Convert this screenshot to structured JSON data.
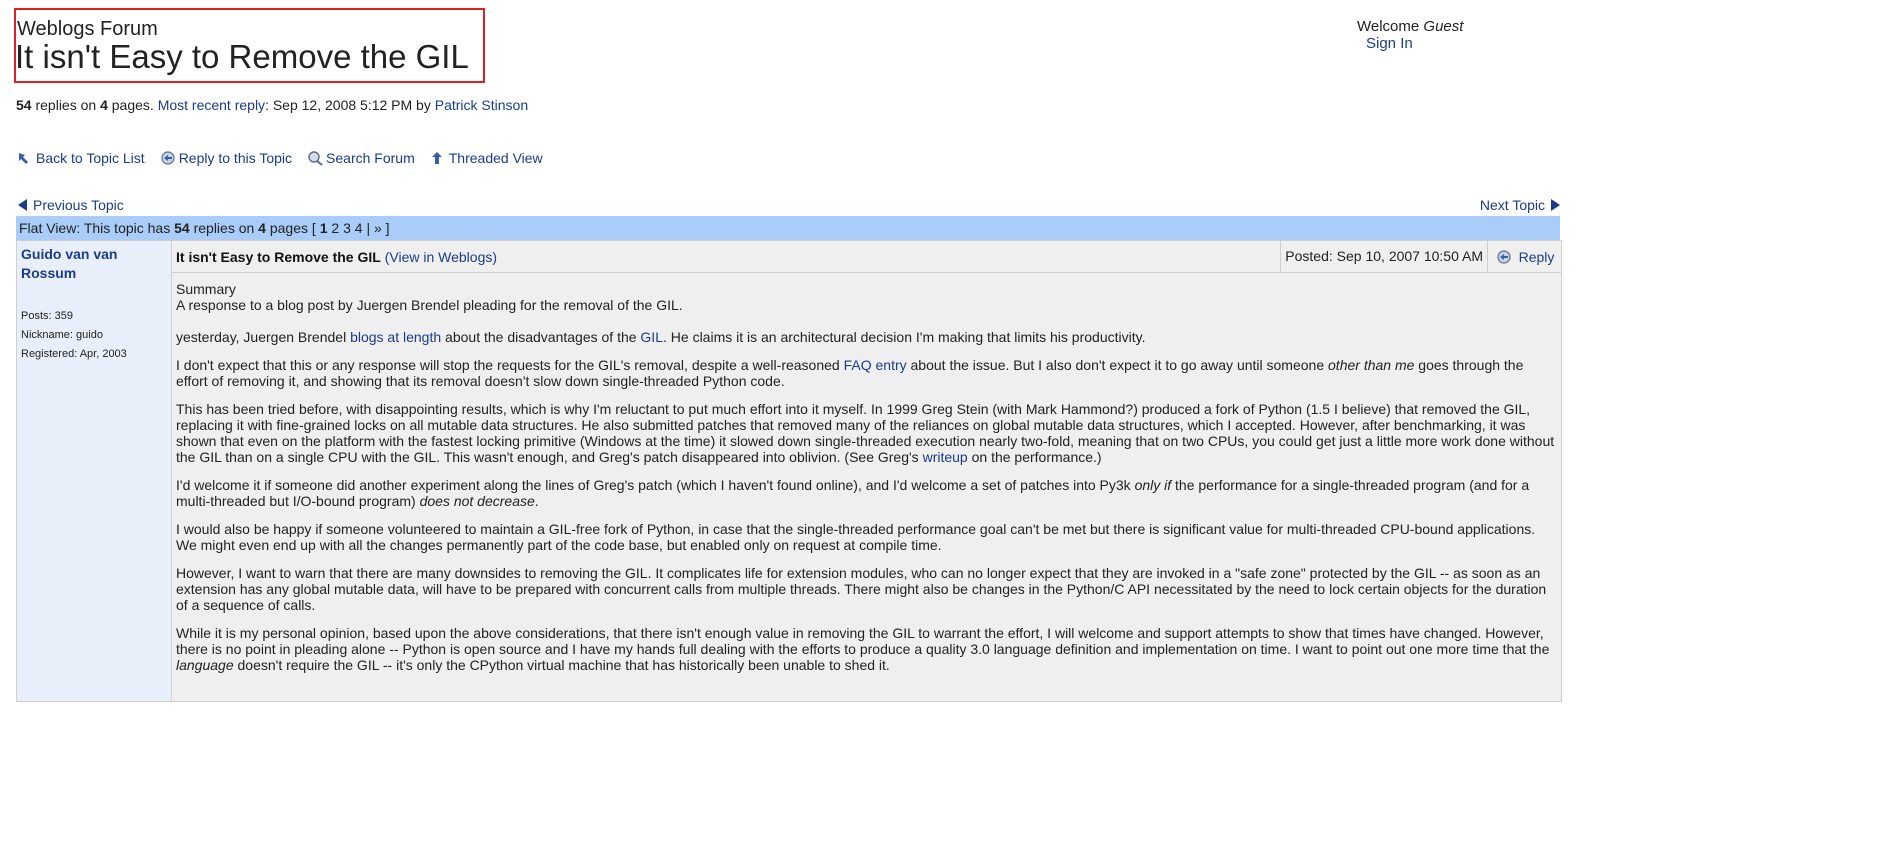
{
  "header": {
    "forum_name": "Weblogs Forum",
    "topic_title": "It isn't Easy to Remove the GIL"
  },
  "user": {
    "welcome": "Welcome",
    "guest": "Guest",
    "sign_in": "Sign In"
  },
  "stats": {
    "replies": "54",
    "replies_label": "replies on",
    "pages": "4",
    "pages_label": "pages.",
    "recent_label": "Most recent reply",
    "recent_date": ": Sep 12, 2008 5:12 PM by",
    "recent_author": "Patrick Stinson"
  },
  "actions": [
    {
      "label": "Back to Topic List",
      "icon": "back-arrow-icon"
    },
    {
      "label": "Reply to this Topic",
      "icon": "reply-icon"
    },
    {
      "label": "Search Forum",
      "icon": "search-icon"
    },
    {
      "label": "Threaded View",
      "icon": "threaded-view-icon"
    }
  ],
  "nav": {
    "prev": "Previous Topic",
    "next": "Next Topic"
  },
  "flatbar": {
    "prefix": "Flat View: This topic has",
    "replies": "54",
    "mid": "replies on",
    "pages": "4",
    "pages_label": "pages [",
    "current_page": "1",
    "page2": "2",
    "page3": "3",
    "page4": "4",
    "sep": "|",
    "next": "»",
    "close": "]"
  },
  "post": {
    "author": "Guido van van Rossum",
    "posts": "Posts: 359",
    "nickname": "Nickname: guido",
    "registered": "Registered: Apr, 2003",
    "title": "It isn't Easy to Remove the GIL",
    "view_in": "(View in Weblogs)",
    "posted": "Posted: Sep 10, 2007 10:50 AM",
    "reply": "Reply",
    "summary_label": "Summary",
    "summary": "A response to a blog post by Juergen Brendel pleading for the removal of the GIL.",
    "p1_a": "yesterday, Juergen Brendel",
    "p1_link1": "blogs at length",
    "p1_b": "about the disadvantages of the",
    "p1_link2": "GIL",
    "p1_c": ". He claims it is an architectural decision I'm making that limits his productivity.",
    "p2_a": "I don't expect that this or any response will stop the requests for the GIL's removal, despite a well-reasoned",
    "p2_link": "FAQ entry",
    "p2_b": "about the issue. But I also don't expect it to go away until someone",
    "p2_em": "other than me",
    "p2_c": "goes through the effort of removing it, and showing that its removal doesn't slow down single-threaded Python code.",
    "p3_a": "This has been tried before, with disappointing results, which is why I'm reluctant to put much effort into it myself. In 1999 Greg Stein (with Mark Hammond?) produced a fork of Python (1.5 I believe) that removed the GIL, replacing it with fine-grained locks on all mutable data structures. He also submitted patches that removed many of the reliances on global mutable data structures, which I accepted. However, after benchmarking, it was shown that even on the platform with the fastest locking primitive (Windows at the time) it slowed down single-threaded execution nearly two-fold, meaning that on two CPUs, you could get just a little more work done without the GIL than on a single CPU with the GIL. This wasn't enough, and Greg's patch disappeared into oblivion. (See Greg's",
    "p3_link": "writeup",
    "p3_b": "on the performance.)",
    "p4_a": "I'd welcome it if someone did another experiment along the lines of Greg's patch (which I haven't found online), and I'd welcome a set of patches into Py3k",
    "p4_em1": "only if",
    "p4_b": "the performance for a single-threaded program (and for a multi-threaded but I/O-bound program)",
    "p4_em2": "does not decrease",
    "p4_c": ".",
    "p5": "I would also be happy if someone volunteered to maintain a GIL-free fork of Python, in case that the single-threaded performance goal can't be met but there is significant value for multi-threaded CPU-bound applications. We might even end up with all the changes permanently part of the code base, but enabled only on request at compile time.",
    "p6": "However, I want to warn that there are many downsides to removing the GIL. It complicates life for extension modules, who can no longer expect that they are invoked in a \"safe zone\" protected by the GIL -- as soon as an extension has any global mutable data, will have to be prepared with concurrent calls from multiple threads. There might also be changes in the Python/C API necessitated by the need to lock certain objects for the duration of a sequence of calls.",
    "p7_a": "While it is my personal opinion, based upon the above considerations, that there isn't enough value in removing the GIL to warrant the effort, I will welcome and support attempts to show that times have changed. However, there is no point in pleading alone -- Python is open source and I have my hands full dealing with the efforts to produce a quality 3.0 language definition and implementation on time. I want to point out one more time that the",
    "p7_em": "language",
    "p7_b": "doesn't require the GIL -- it's only the CPython virtual machine that has historically been unable to shed it."
  },
  "colors": {
    "link": "#1a3c8c",
    "flatbar": "#a9ccf9",
    "author_col": "#e8effb",
    "highlight_box": "#e02020"
  }
}
